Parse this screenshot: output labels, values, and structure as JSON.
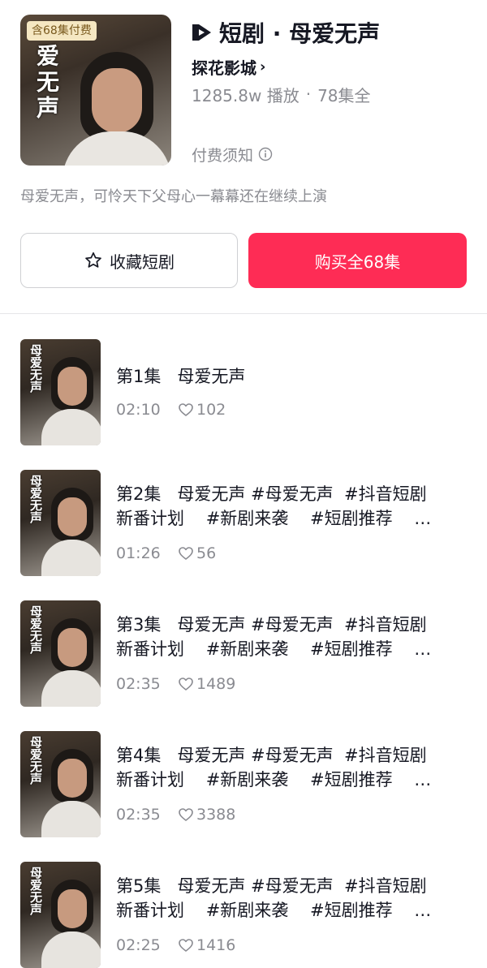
{
  "header": {
    "cover_badge": "含68集付费",
    "cover_calligraphy": "爱无声",
    "title": "短剧 · 母爱无声",
    "studio": "探花影城",
    "plays": "1285.8w 播放",
    "episodes_total": "78集全",
    "notice_label": "付费须知",
    "synopsis": "母爱无声，可怜天下父母心一幕幕还在继续上演",
    "collect_label": "收藏短剧",
    "buy_label": "购买全68集"
  },
  "colors": {
    "accent": "#fe2c55",
    "text_primary": "#161823",
    "text_secondary": "#8a8b91"
  },
  "icons": [
    "play-logo-icon",
    "chevron-right-icon",
    "info-icon",
    "star-icon",
    "heart-icon"
  ],
  "episodes": [
    {
      "title": "第1集   母爱无声",
      "duration": "02:10",
      "likes": "102"
    },
    {
      "title": "第2集   母爱无声 #母爱无声  #抖音短剧\n新番计划    #新剧来袭    #短剧推荐    …",
      "duration": "01:26",
      "likes": "56"
    },
    {
      "title": "第3集   母爱无声 #母爱无声  #抖音短剧\n新番计划    #新剧来袭    #短剧推荐    …",
      "duration": "02:35",
      "likes": "1489"
    },
    {
      "title": "第4集   母爱无声 #母爱无声  #抖音短剧\n新番计划    #新剧来袭    #短剧推荐    …",
      "duration": "02:35",
      "likes": "3388"
    },
    {
      "title": "第5集   母爱无声 #母爱无声  #抖音短剧\n新番计划    #新剧来袭    #短剧推荐    …",
      "duration": "02:25",
      "likes": "1416"
    }
  ],
  "thumb_calligraphy": "母爱无声"
}
